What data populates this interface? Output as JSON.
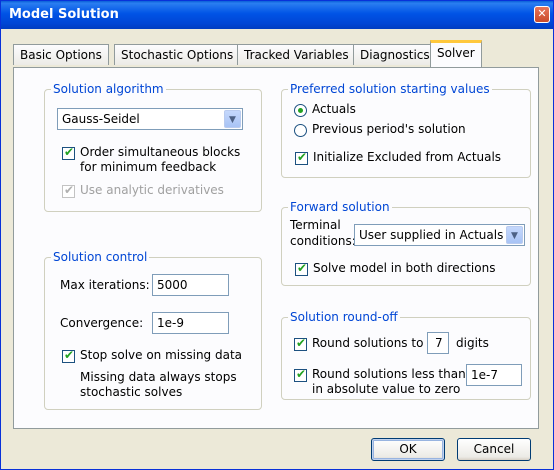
{
  "window": {
    "title": "Model Solution",
    "close_glyph": "✕"
  },
  "tabs": [
    {
      "label": "Basic Options"
    },
    {
      "label": "Stochastic Options"
    },
    {
      "label": "Tracked Variables"
    },
    {
      "label": "Diagnostics"
    },
    {
      "label": "Solver",
      "active": true
    }
  ],
  "solution_algorithm": {
    "legend": "Solution algorithm",
    "selected": "Gauss-Seidel",
    "order_blocks": {
      "label_line1": "Order simultaneous blocks",
      "label_line2": "for minimum feedback",
      "checked": true
    },
    "analytic_derivatives": {
      "label": "Use analytic derivatives",
      "checked": true,
      "disabled": true
    }
  },
  "solution_control": {
    "legend": "Solution control",
    "max_iterations_label": "Max iterations:",
    "max_iterations_value": "5000",
    "convergence_label": "Convergence:",
    "convergence_value": "1e-9",
    "stop_on_missing": {
      "label": "Stop solve on missing data",
      "checked": true
    },
    "note_line1": "Missing data always stops",
    "note_line2": "stochastic solves"
  },
  "preferred_start": {
    "legend": "Preferred solution starting values",
    "actuals_label": "Actuals",
    "previous_label": "Previous period's solution",
    "selected": "actuals",
    "initialize_excluded": {
      "label": "Initialize Excluded from Actuals",
      "checked": true
    }
  },
  "forward_solution": {
    "legend": "Forward solution",
    "terminal_label_line1": "Terminal",
    "terminal_label_line2": "conditions:",
    "terminal_selected": "User supplied in Actuals",
    "solve_both": {
      "label": "Solve model in both directions",
      "checked": true
    }
  },
  "roundoff": {
    "legend": "Solution round-off",
    "round_to_label": "Round solutions to",
    "round_digits": "7",
    "digits_label": "digits",
    "round_less_line1": "Round solutions less than",
    "round_less_line2": "in absolute value to zero",
    "round_less_value": "1e-7",
    "round_to_checked": true,
    "round_less_checked": true
  },
  "buttons": {
    "ok": "OK",
    "cancel": "Cancel"
  },
  "colors": {
    "title_bar": "#0053e6",
    "group_legend": "#0046d5",
    "dialog_bg": "#ece9d8",
    "check_mark": "#21a121"
  }
}
